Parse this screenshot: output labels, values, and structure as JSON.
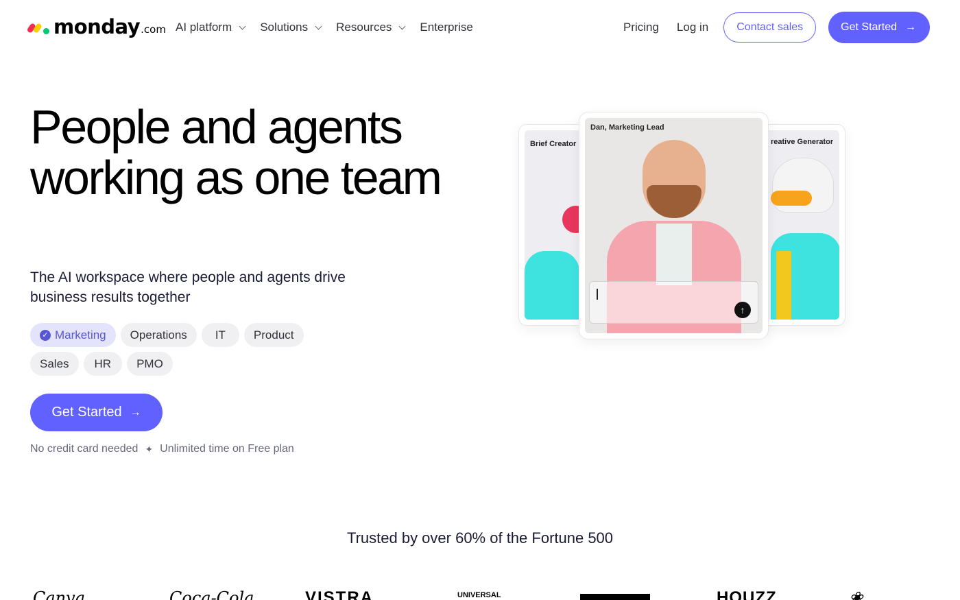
{
  "nav": {
    "logo_text": "monday",
    "logo_suffix": ".com",
    "menu": [
      {
        "label": "AI platform",
        "dropdown": true
      },
      {
        "label": "Solutions",
        "dropdown": true
      },
      {
        "label": "Resources",
        "dropdown": true
      },
      {
        "label": "Enterprise",
        "dropdown": false
      }
    ],
    "pricing": "Pricing",
    "login": "Log in",
    "contact": "Contact sales",
    "get_started": "Get Started"
  },
  "hero": {
    "title": "People and agents working as one team",
    "subtitle": "The AI workspace where people and agents drive business results together",
    "chips": [
      {
        "label": "Marketing",
        "selected": true
      },
      {
        "label": "Operations",
        "selected": false
      },
      {
        "label": "IT",
        "selected": false
      },
      {
        "label": "Product",
        "selected": false
      },
      {
        "label": "Sales",
        "selected": false
      },
      {
        "label": "HR",
        "selected": false
      },
      {
        "label": "PMO",
        "selected": false
      }
    ],
    "cta": "Get Started",
    "note_1": "No credit card needed",
    "note_sep": "✦",
    "note_2": "Unlimited time on Free plan"
  },
  "cards": {
    "left_title": "Brief Creator",
    "center_title": "Dan, Marketing Lead",
    "right_title": "reative Generator"
  },
  "trusted": {
    "heading": "Trusted by over 60% of the Fortune 500",
    "brands": [
      "Canva",
      "Coca-Cola",
      "VISTRA",
      "UNIVERSAL",
      "HOUZZ"
    ]
  },
  "colors": {
    "primary": "#6161ff",
    "chip_bg": "#f0f0f3",
    "chip_selected_bg": "#e3e3fb",
    "teal": "#3ee3e0"
  }
}
